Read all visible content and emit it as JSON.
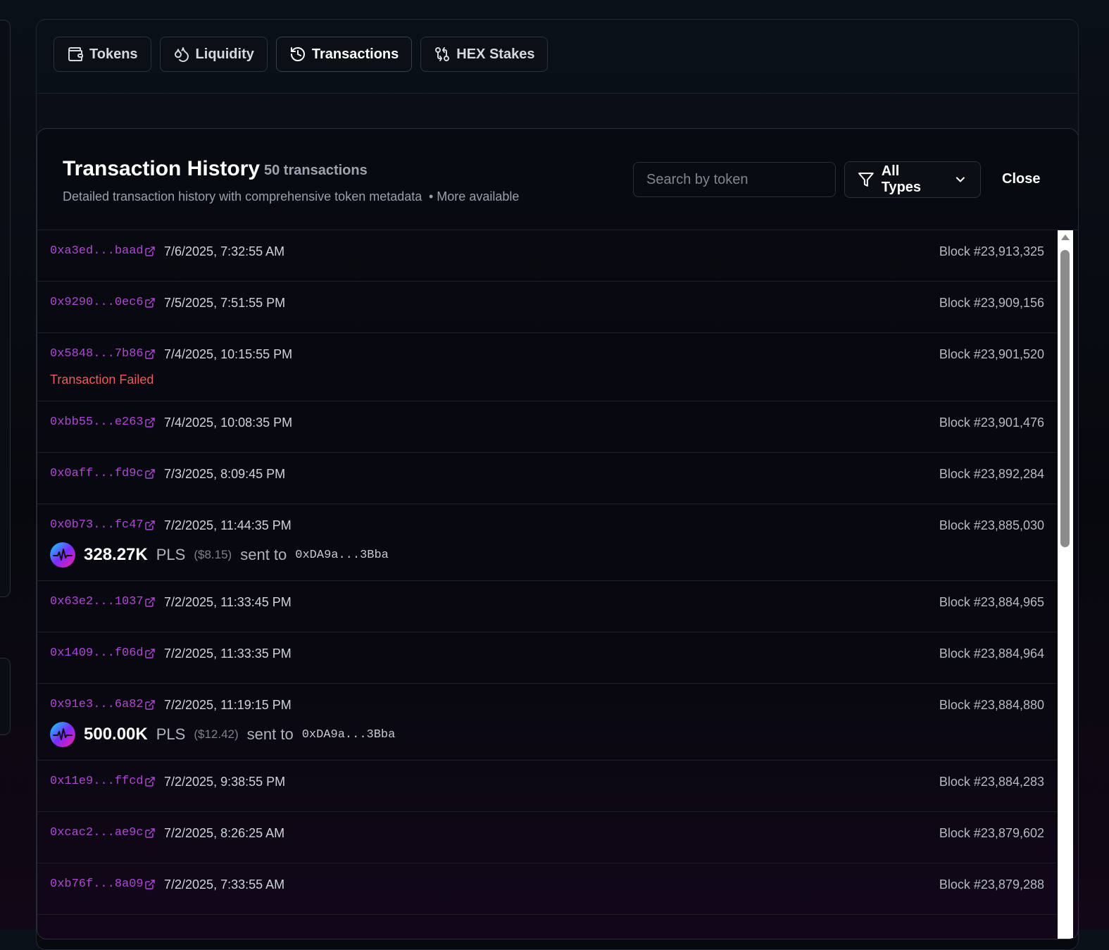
{
  "tabs": [
    {
      "label": "Tokens",
      "icon": "wallet-icon"
    },
    {
      "label": "Liquidity",
      "icon": "droplets-icon"
    },
    {
      "label": "Transactions",
      "icon": "history-icon"
    },
    {
      "label": "HEX Stakes",
      "icon": "git-compare-icon"
    }
  ],
  "modal": {
    "title": "Transaction History",
    "count": "50 transactions",
    "subtitle": "Detailed transaction history with comprehensive token metadata",
    "more": "• More available",
    "search_placeholder": "Search by token",
    "filter_label": "All Types",
    "close_label": "Close"
  },
  "transactions": [
    {
      "hash": "0xa3ed...baad",
      "date": "7/6/2025, 7:32:55 AM",
      "block": "Block #23,913,325"
    },
    {
      "hash": "0x9290...0ec6",
      "date": "7/5/2025, 7:51:55 PM",
      "block": "Block #23,909,156"
    },
    {
      "hash": "0x5848...7b86",
      "date": "7/4/2025, 10:15:55 PM",
      "block": "Block #23,901,520",
      "status": "Transaction Failed"
    },
    {
      "hash": "0xbb55...e263",
      "date": "7/4/2025, 10:08:35 PM",
      "block": "Block #23,901,476"
    },
    {
      "hash": "0x0aff...fd9c",
      "date": "7/3/2025, 8:09:45 PM",
      "block": "Block #23,892,284"
    },
    {
      "hash": "0x0b73...fc47",
      "date": "7/2/2025, 11:44:35 PM",
      "block": "Block #23,885,030",
      "transfer": {
        "amount": "328.27K",
        "symbol": "PLS",
        "usd": "($8.15)",
        "action": "sent to",
        "to": "0xDA9a...3Bba"
      }
    },
    {
      "hash": "0x63e2...1037",
      "date": "7/2/2025, 11:33:45 PM",
      "block": "Block #23,884,965"
    },
    {
      "hash": "0x1409...f06d",
      "date": "7/2/2025, 11:33:35 PM",
      "block": "Block #23,884,964"
    },
    {
      "hash": "0x91e3...6a82",
      "date": "7/2/2025, 11:19:15 PM",
      "block": "Block #23,884,880",
      "transfer": {
        "amount": "500.00K",
        "symbol": "PLS",
        "usd": "($12.42)",
        "action": "sent to",
        "to": "0xDA9a...3Bba"
      }
    },
    {
      "hash": "0x11e9...ffcd",
      "date": "7/2/2025, 9:38:55 PM",
      "block": "Block #23,884,283"
    },
    {
      "hash": "0xcac2...ae9c",
      "date": "7/2/2025, 8:26:25 AM",
      "block": "Block #23,879,602"
    },
    {
      "hash": "0xb76f...8a09",
      "date": "7/2/2025, 7:33:55 AM",
      "block": "Block #23,879,288"
    }
  ],
  "colors": {
    "hash": "#b047d8",
    "failed": "#ef5a5a",
    "background": "#07080e"
  }
}
